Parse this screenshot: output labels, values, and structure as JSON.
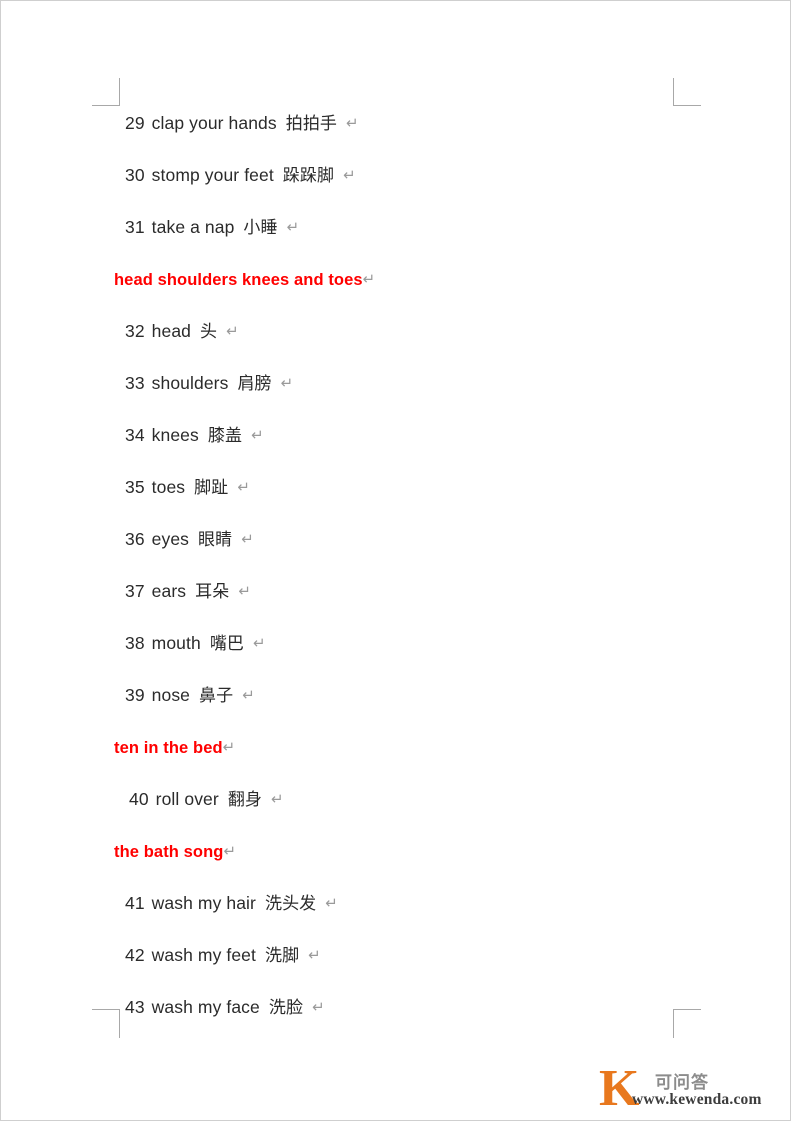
{
  "document": {
    "page_marks": {
      "top_left": "crop-mark",
      "top_right": "crop-mark",
      "bottom_left": "crop-mark",
      "bottom_right": "crop-mark"
    },
    "pilcrow_symbol": "↵",
    "heading_color": "#ff0000",
    "body_color": "#2b2b2b",
    "lines": [
      {
        "kind": "item",
        "number": "29",
        "english": "clap your hands",
        "chinese": "拍拍手",
        "mark": "↵"
      },
      {
        "kind": "item",
        "number": "30",
        "english": "stomp your feet",
        "chinese": "跺跺脚",
        "mark": "↵"
      },
      {
        "kind": "item",
        "number": "31",
        "english": "take a nap",
        "chinese": "小睡",
        "mark": "↵"
      },
      {
        "kind": "heading",
        "title": "head shoulders knees and toes",
        "mark": "↵"
      },
      {
        "kind": "item",
        "number": "32",
        "english": "head",
        "chinese": "头",
        "mark": "↵"
      },
      {
        "kind": "item",
        "number": "33",
        "english": "shoulders",
        "chinese": "肩膀",
        "mark": "↵"
      },
      {
        "kind": "item",
        "number": "34",
        "english": "knees",
        "chinese": "膝盖",
        "mark": "↵"
      },
      {
        "kind": "item",
        "number": "35",
        "english": "toes",
        "chinese": "脚趾",
        "mark": "↵"
      },
      {
        "kind": "item",
        "number": "36",
        "english": "eyes",
        "chinese": "眼睛",
        "mark": "↵"
      },
      {
        "kind": "item",
        "number": "37",
        "english": "ears",
        "chinese": "耳朵",
        "mark": "↵"
      },
      {
        "kind": "item",
        "number": "38",
        "english": "mouth",
        "chinese": "嘴巴",
        "mark": "↵"
      },
      {
        "kind": "item",
        "number": "39",
        "english": "nose",
        "chinese": "鼻子",
        "mark": "↵"
      },
      {
        "kind": "heading",
        "title": "ten in the bed",
        "mark": "↵"
      },
      {
        "kind": "item",
        "number": "40",
        "english": "roll over",
        "chinese": "翻身",
        "mark": "↵"
      },
      {
        "kind": "heading",
        "title": "the bath song",
        "mark": "↵"
      },
      {
        "kind": "item",
        "number": "41",
        "english": "wash my hair",
        "chinese": "洗头发",
        "mark": "↵"
      },
      {
        "kind": "item",
        "number": "42",
        "english": "wash my feet",
        "chinese": "洗脚",
        "mark": "↵"
      },
      {
        "kind": "item",
        "number": "43",
        "english": "wash my face",
        "chinese": "洗脸",
        "mark": "↵"
      }
    ]
  },
  "watermark": {
    "logo_letter": "K",
    "chinese_name": "可问答",
    "url": "www.kewenda.com",
    "logo_color": "#e8781e",
    "chinese_color": "#8c8c8c",
    "url_color": "#3d3d3d"
  }
}
